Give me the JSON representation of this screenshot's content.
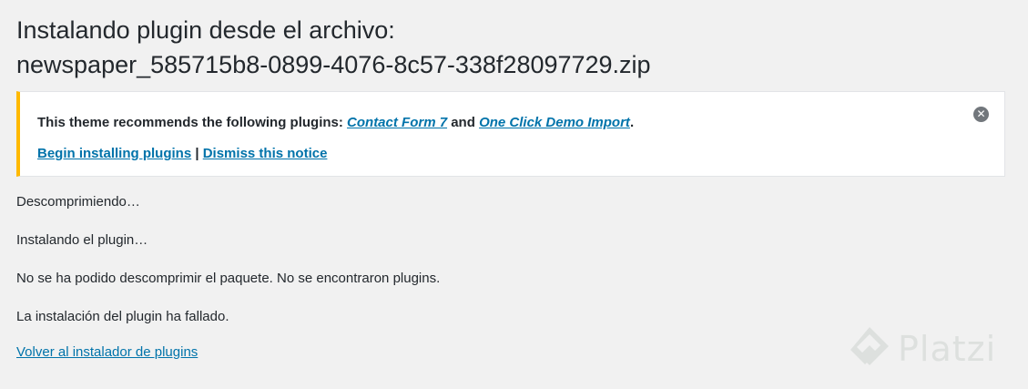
{
  "page": {
    "title_line1": "Instalando plugin desde el archivo:",
    "title_line2": "newspaper_585715b8-0899-4076-8c57-338f28097729.zip"
  },
  "notice": {
    "text_before": "This theme recommends the following plugins: ",
    "plugin1": "Contact Form 7",
    "text_and": " and ",
    "plugin2": "One Click Demo Import",
    "text_after": ".",
    "begin_link": "Begin installing plugins",
    "separator": " | ",
    "dismiss_link": "Dismiss this notice",
    "close_glyph": "✕",
    "accent_color": "#ffb900"
  },
  "log": {
    "lines": [
      "Descomprimiendo…",
      "Instalando el plugin…",
      "No se ha podido descomprimir el paquete. No se encontraron plugins.",
      "La instalación del plugin ha fallado."
    ],
    "back_link": "Volver al instalador de plugins"
  },
  "watermark": {
    "brand": "Platzi"
  },
  "colors": {
    "link": "#0073aa",
    "text": "#23282d",
    "background": "#f1f1f1"
  }
}
